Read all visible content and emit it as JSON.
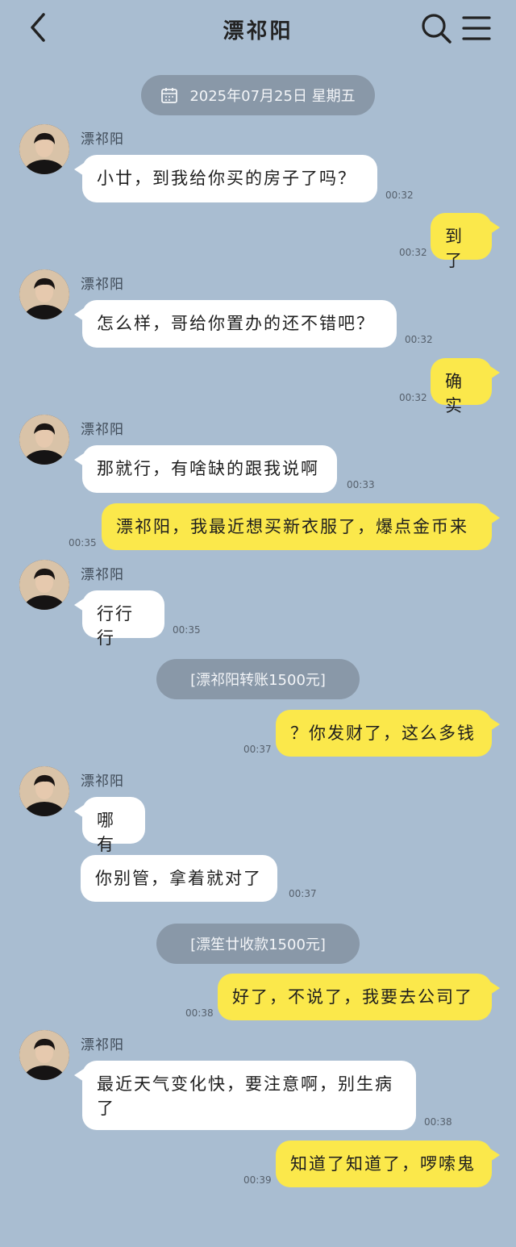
{
  "header": {
    "title": "漂祁阳"
  },
  "date_pill": "2025年07月25日 星期五",
  "contact_name": "漂祁阳",
  "messages": [
    {
      "text": "小廿，到我给你买的房子了吗？",
      "time": "00:32"
    },
    {
      "text": "到了",
      "time": "00:32"
    },
    {
      "text": "怎么样，哥给你置办的还不错吧？",
      "time": "00:32"
    },
    {
      "text": "确实",
      "time": "00:32"
    },
    {
      "text": "那就行，有啥缺的跟我说啊",
      "time": "00:33"
    },
    {
      "text": "漂祁阳，我最近想买新衣服了，爆点金币来",
      "time": "00:35"
    },
    {
      "text": "行行行",
      "time": "00:35"
    },
    {
      "text": "？你发财了，这么多钱",
      "time": "00:37"
    },
    {
      "text": "哪有",
      "time": ""
    },
    {
      "text": "你别管，拿着就对了",
      "time": "00:37"
    },
    {
      "text": "好了，不说了，我要去公司了",
      "time": "00:38"
    },
    {
      "text": "最近天气变化快，要注意啊，别生病了",
      "time": "00:38"
    },
    {
      "text": "知道了知道了，啰嗦鬼",
      "time": "00:39"
    }
  ],
  "transfers": [
    "[漂祁阳转账1500元]",
    "[漂笙廿收款1500元]"
  ],
  "colors": {
    "background": "#a9bdd1",
    "incoming_bubble": "#ffffff",
    "outgoing_bubble": "#fbe84b",
    "pill": "#8998a8"
  }
}
